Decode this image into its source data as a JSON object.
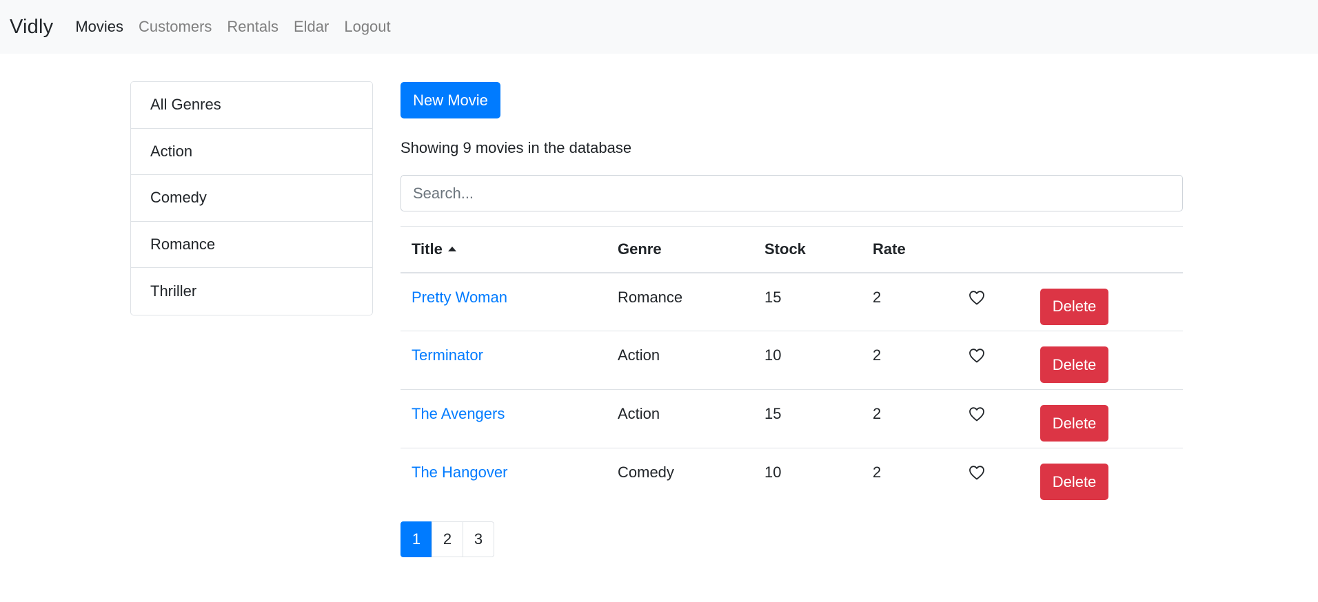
{
  "navbar": {
    "brand": "Vidly",
    "links": [
      {
        "label": "Movies",
        "active": true
      },
      {
        "label": "Customers",
        "active": false
      },
      {
        "label": "Rentals",
        "active": false
      },
      {
        "label": "Eldar",
        "active": false
      },
      {
        "label": "Logout",
        "active": false
      }
    ]
  },
  "genres": [
    "All Genres",
    "Action",
    "Comedy",
    "Romance",
    "Thriller"
  ],
  "main": {
    "new_button": "New Movie",
    "count_text": "Showing 9 movies in the database",
    "search_placeholder": "Search...",
    "search_value": ""
  },
  "table": {
    "headers": [
      "Title",
      "Genre",
      "Stock",
      "Rate"
    ],
    "sort_column": "Title",
    "sort_order": "asc",
    "rows": [
      {
        "title": "Pretty Woman",
        "genre": "Romance",
        "stock": "15",
        "rate": "2",
        "liked": false,
        "delete": "Delete"
      },
      {
        "title": "Terminator",
        "genre": "Action",
        "stock": "10",
        "rate": "2",
        "liked": false,
        "delete": "Delete"
      },
      {
        "title": "The Avengers",
        "genre": "Action",
        "stock": "15",
        "rate": "2",
        "liked": false,
        "delete": "Delete"
      },
      {
        "title": "The Hangover",
        "genre": "Comedy",
        "stock": "10",
        "rate": "2",
        "liked": false,
        "delete": "Delete"
      }
    ]
  },
  "pagination": {
    "pages": [
      "1",
      "2",
      "3"
    ],
    "current": "1"
  },
  "colors": {
    "primary": "#007bff",
    "danger": "#dc3545",
    "navbar_bg": "#f8f9fa"
  },
  "icons": {
    "like": "heart-outline-icon",
    "sort": "caret-up-icon"
  }
}
